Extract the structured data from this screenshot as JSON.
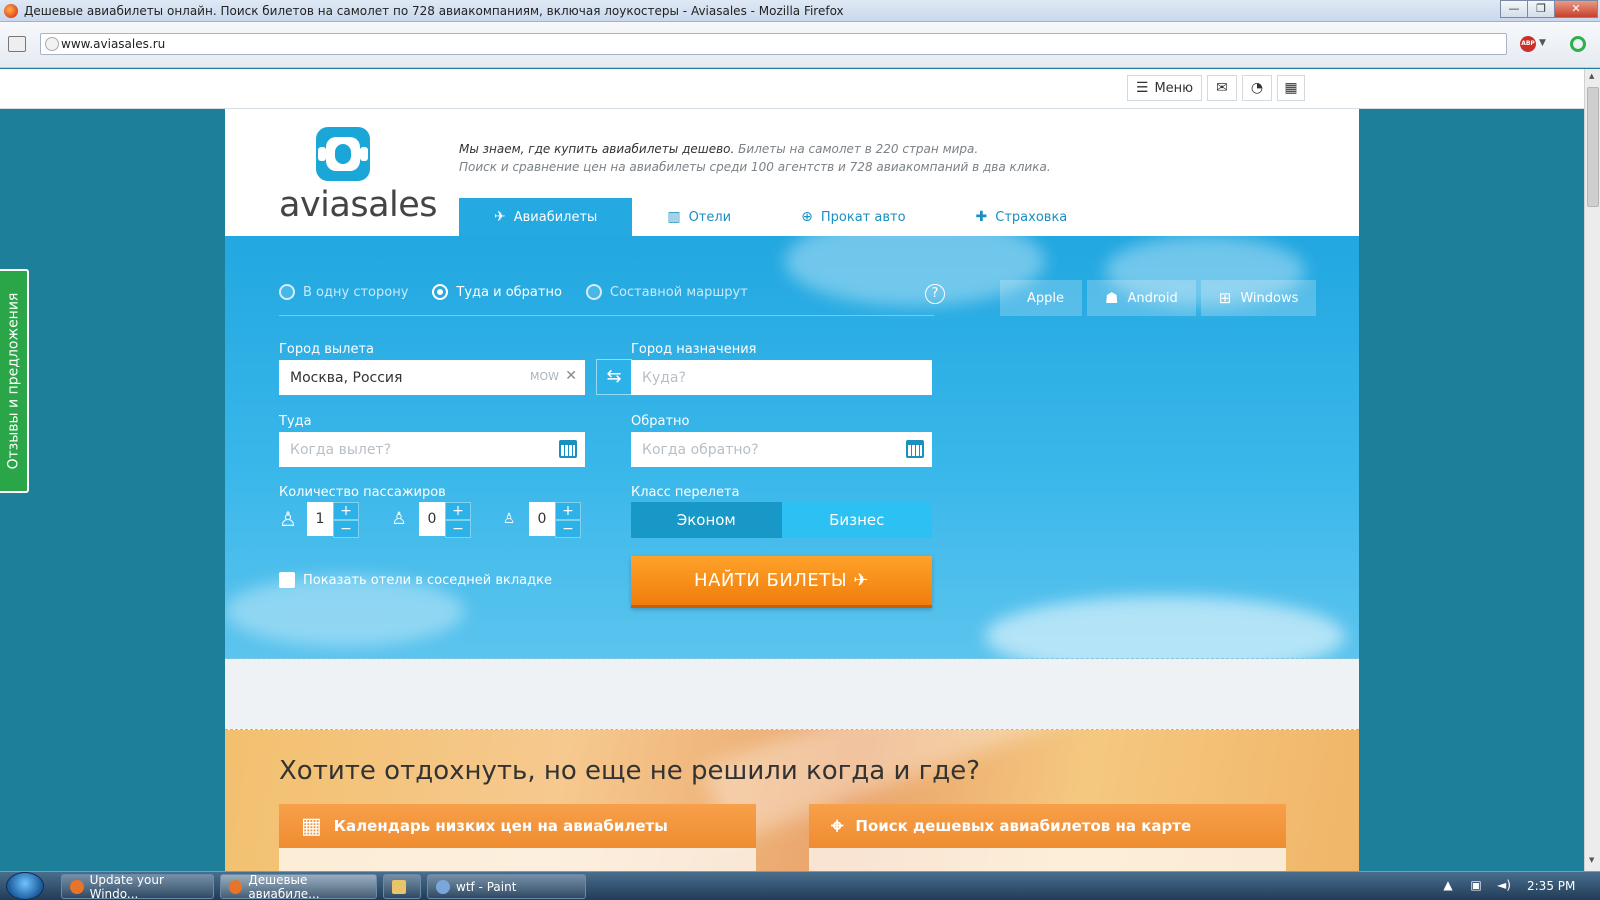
{
  "window": {
    "title": "Дешевые авиабилеты онлайн. Поиск билетов на самолет по 728 авиакомпаниям, включая лоукостеры - Aviasales - Mozilla Firefox",
    "minimize": "—",
    "restore": "❐",
    "close": "✕"
  },
  "browser": {
    "url": "www.aviasales.ru",
    "abp_label": "ABP"
  },
  "topbar": {
    "menu_label": "Меню",
    "menu_icon": "☰",
    "mail_icon": "✉",
    "rss_icon": "◔",
    "calc_icon": "▦"
  },
  "feedback": "Отзывы и предложения",
  "logo": {
    "text": "aviasales"
  },
  "tagline": {
    "bold": "Мы знаем, где купить авиабилеты дешево.",
    "rest": " Билеты на самолет в 220 стран мира.",
    "line2": "Поиск и сравнение цен на авиабилеты среди 100 агентств и 728 авиакомпаний в два клика."
  },
  "tabs": [
    {
      "label": "Авиабилеты",
      "icon": "✈",
      "active": true
    },
    {
      "label": "Отели",
      "icon": "▥",
      "active": false
    },
    {
      "label": "Прокат авто",
      "icon": "⊕",
      "active": false
    },
    {
      "label": "Страховка",
      "icon": "✚",
      "active": false
    }
  ],
  "trip_types": [
    {
      "label": "В одну сторону",
      "selected": false
    },
    {
      "label": "Туда и обратно",
      "selected": true
    },
    {
      "label": "Составной маршрут",
      "selected": false
    }
  ],
  "help": "?",
  "form": {
    "origin_label": "Город вылета",
    "origin_value": "Москва, Россия",
    "origin_code": "MOW",
    "clear_icon": "✕",
    "swap_icon": "⇆",
    "destination_label": "Город назначения",
    "destination_placeholder": "Куда?",
    "depart_label": "Туда",
    "depart_placeholder": "Когда вылет?",
    "return_label": "Обратно",
    "return_placeholder": "Когда обратно?",
    "passengers_label": "Количество пассажиров",
    "passengers": [
      {
        "type": "adult",
        "icon": "♙",
        "count": "1"
      },
      {
        "type": "child",
        "icon": "♙",
        "count": "0"
      },
      {
        "type": "infant",
        "icon": "♙",
        "count": "0"
      }
    ],
    "plus": "+",
    "minus": "−",
    "class_label": "Класс перелета",
    "class_economy": "Эконом",
    "class_business": "Бизнес",
    "hotels_checkbox": "Показать отели в соседней вкладке",
    "search_button": "НАЙТИ БИЛЕТЫ ✈"
  },
  "apps": [
    {
      "label": "Apple",
      "icon": ""
    },
    {
      "label": "Android",
      "icon": "☗"
    },
    {
      "label": "Windows",
      "icon": "⊞"
    }
  ],
  "promo": {
    "title": "Хотите отдохнуть, но еще не решили когда и где?",
    "card1": "Календарь низких цен на авиабилеты",
    "card1_icon": "▦",
    "card2": "Поиск дешевых авиабилетов на карте",
    "card2_icon": "⌖"
  },
  "taskbar": {
    "tasks": [
      {
        "label": "Update your Windo...",
        "active": false
      },
      {
        "label": "Дешевые авиабиле...",
        "active": true
      },
      {
        "label": "",
        "active": false
      },
      {
        "label": "wtf - Paint",
        "active": false
      }
    ],
    "time": "2:35 PM",
    "tray_up": "▲",
    "tray_net": "▣",
    "tray_vol": "◄)"
  },
  "colors": {
    "accent": "#24a9e1",
    "cta": "#f7931e",
    "feedback": "#2aa548",
    "page_bg": "#1d7f99"
  }
}
